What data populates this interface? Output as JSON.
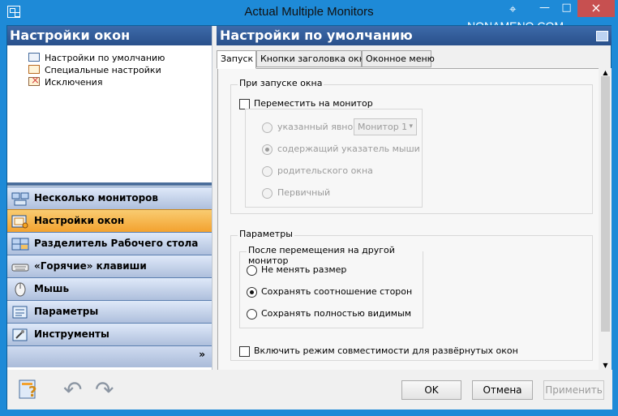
{
  "window": {
    "title": "Actual Multiple Monitors",
    "watermark": "NONAMENO.COM",
    "controls": {
      "minimize": "—",
      "maximize": "□",
      "close": "×"
    },
    "colors": {
      "title_bar": "#1e8ad7",
      "panel_header": "#3d6aa9",
      "active_nav": "#f3a22f"
    }
  },
  "sidebar": {
    "header": "Настройки окон",
    "tree": [
      {
        "label": "Настройки по умолчанию",
        "icon": "window-settings-icon"
      },
      {
        "label": "Специальные настройки",
        "icon": "special-settings-icon"
      },
      {
        "label": "Исключения",
        "icon": "exceptions-icon"
      }
    ],
    "nav": [
      {
        "label": "Несколько мониторов",
        "icon": "multiple-monitors-icon",
        "active": false
      },
      {
        "label": "Настройки окон",
        "icon": "window-settings-icon",
        "active": true
      },
      {
        "label": "Разделитель Рабочего стола",
        "icon": "desktop-divider-icon",
        "active": false
      },
      {
        "label": "«Горячие» клавиши",
        "icon": "keyboard-icon",
        "active": false
      },
      {
        "label": "Мышь",
        "icon": "mouse-icon",
        "active": false
      },
      {
        "label": "Параметры",
        "icon": "parameters-icon",
        "active": false
      },
      {
        "label": "Инструменты",
        "icon": "tools-icon",
        "active": false
      }
    ],
    "expand": "»"
  },
  "main": {
    "header": "Настройки по умолчанию",
    "tabs": [
      {
        "label": "Запуск",
        "active": true
      },
      {
        "label": "Кнопки заголовка окна",
        "active": false
      },
      {
        "label": "Оконное меню",
        "active": false
      }
    ],
    "launch": {
      "title": "При запуске окна",
      "move_monitor": {
        "label": "Переместить на монитор",
        "checked": false
      },
      "options": [
        {
          "label": "указанный явно",
          "checked": false
        },
        {
          "label": "содержащий указатель мыши",
          "checked": true
        },
        {
          "label": "родительского окна",
          "checked": false
        },
        {
          "label": "Первичный",
          "checked": false
        }
      ],
      "monitor_select": {
        "value": "Монитор 1"
      }
    },
    "parameters": {
      "title": "Параметры",
      "after_move_title": "После перемещения на другой монитор",
      "options": [
        {
          "label": "Не менять размер",
          "checked": false
        },
        {
          "label": "Сохранять соотношение сторон",
          "checked": true
        },
        {
          "label": "Сохранять полностью видимым",
          "checked": false
        }
      ]
    },
    "compatibility": {
      "label": "Включить режим совместимости для развёрнутых окон",
      "checked": false
    }
  },
  "footer": {
    "ok": "OK",
    "cancel": "Отмена",
    "apply": "Применить"
  }
}
